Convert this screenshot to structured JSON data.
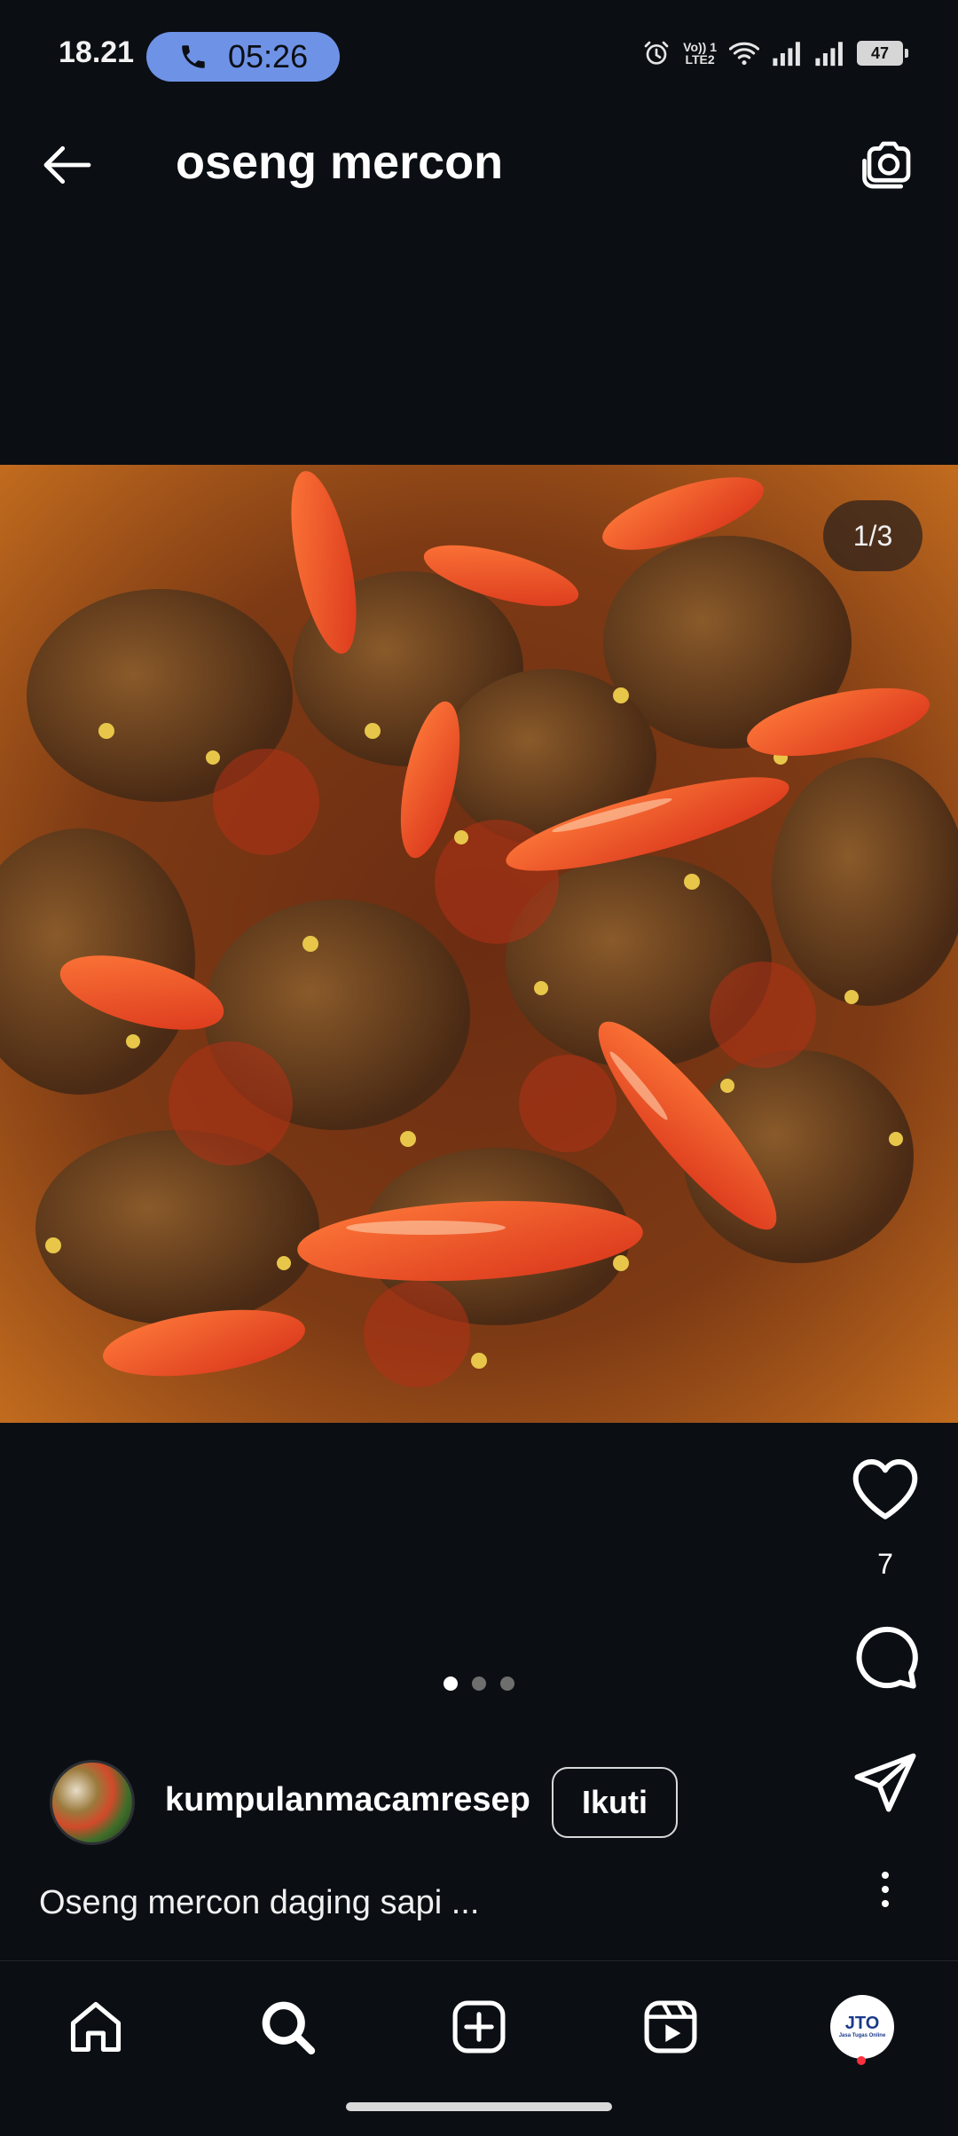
{
  "status_bar": {
    "time": "18.21",
    "call_timer": "05:26",
    "network_label_top": "Vo)) 1",
    "network_label_bottom": "LTE2",
    "battery": "47"
  },
  "header": {
    "title": "oseng mercon"
  },
  "post": {
    "image_counter": "1/3",
    "total_images": 3,
    "active_image_index": 0,
    "like_count": "7",
    "author": "kumpulanmacamresep",
    "follow_label": "Ikuti",
    "caption": "Oseng mercon daging sapi ..."
  },
  "icons": {
    "back": "arrow-left-icon",
    "camera": "camera-icon",
    "like": "heart-icon",
    "comment": "comment-bubble-icon",
    "share": "send-icon",
    "more": "more-vertical-icon",
    "home": "home-icon",
    "search": "search-icon",
    "create": "add-square-icon",
    "reels": "reels-icon",
    "alarm": "alarm-icon",
    "wifi": "wifi-icon",
    "signal": "signal-icon",
    "call": "phone-icon"
  },
  "profile_avatar": {
    "monogram": "JTO",
    "brand_text": "Jasa Tugas Online"
  },
  "colors": {
    "background": "#0b0f14",
    "call_pill": "#6e92e6",
    "notification": "#ff3040"
  }
}
